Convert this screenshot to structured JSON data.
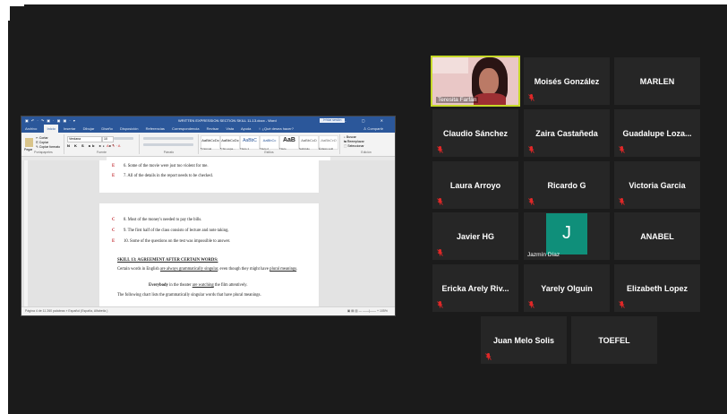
{
  "word": {
    "quick_access": "▣ ↶ · ↷ ▣ · ▣ ▣ · ▾",
    "doc_title": "WRITTEN EXPRESSION SECTION SKILL 11-13.docx  -  Word",
    "sign_in": "Iniciar sesión",
    "window_buttons": "▭ — ▢ ✕",
    "tabs": [
      "Archivo",
      "Inicio",
      "Insertar",
      "Dibujar",
      "Diseño",
      "Disposición",
      "Referencias",
      "Correspondencia",
      "Revisar",
      "Vista",
      "Ayuda",
      "♀ ¿Qué desea hacer?"
    ],
    "active_tab": "Inicio",
    "share": "♙ Compartir",
    "ribbon": {
      "clipboard_label": "Portapapeles",
      "paste": "Pegar",
      "cut": "✂ Cortar",
      "copy": "⎘ Copiar",
      "format_painter": "✎ Copiar formato",
      "font_name": "Verdana",
      "font_size": "10",
      "font_label": "Fuente",
      "paragraph_label": "Párrafo",
      "styles": [
        "AaBbCcDc",
        "AaBbCcDc",
        "AaBbC",
        "AaBbCc",
        "AaB",
        "AaBbCcD",
        "AaBbCcD"
      ],
      "style_names": [
        "¶ Normal",
        "¶ Sin espa...",
        "Título 1",
        "Título 2",
        "Título",
        "Subtítulo",
        "Énfasis sutil"
      ],
      "styles_label": "Estilos",
      "find": "⌕ Buscar",
      "replace": "⇆ Reemplazar",
      "select": "⬚ Seleccionar",
      "edit_label": "Edición"
    },
    "page1_items": [
      {
        "letter": "E",
        "text": "6.  Some of the movie were just too violent for me."
      },
      {
        "letter": "E",
        "text": "7.  All of the details in the report needs to be checked."
      }
    ],
    "page2_items": [
      {
        "letter": "C",
        "text": "8.  Most of the money's needed to pay the bills."
      },
      {
        "letter": "C",
        "text": "9.  The first half of the class consists of lecture and note taking."
      },
      {
        "letter": "E",
        "text": "10.  Some of the questions on the test was impossible to answer."
      }
    ],
    "skill_heading": "SKILL 13: AGREEMENT AFTER CERTAIN WORDS:",
    "para1_a": "Certain words in English ",
    "para1_u1": "are always grammatically singular",
    "para1_b": ", even though they might have ",
    "para1_u2": "plural meanings",
    "para1_c": ".",
    "example_bold": "Everybody",
    "example_a": " in the theater ",
    "example_u": "are watching",
    "example_b": " the film attentively.",
    "para2": "The following chart lists the grammatically singular words that have plural meanings.",
    "status_left": "Página 4 de 11     260 palabras     ⌖     Español (España, Alfabetiz.)",
    "status_right": "▣  ▤  ▥    —  ——|——  +   105%"
  },
  "participants": [
    {
      "name": "Teresita Farfán",
      "type": "video",
      "muted": false
    },
    {
      "name": "Moisés González",
      "type": "name",
      "muted": true
    },
    {
      "name": "MARLEN",
      "type": "name",
      "muted": false
    },
    {
      "name": "Claudio Sánchez",
      "type": "name",
      "muted": true
    },
    {
      "name": "Zaira Castañeda",
      "type": "name",
      "muted": true
    },
    {
      "name": "Guadalupe  Loza...",
      "type": "name",
      "muted": true
    },
    {
      "name": "Laura Arroyo",
      "type": "name",
      "muted": true
    },
    {
      "name": "Ricardo G",
      "type": "name",
      "muted": true
    },
    {
      "name": "Victoria Garcia",
      "type": "name",
      "muted": true
    },
    {
      "name": "Javier HG",
      "type": "name",
      "muted": true
    },
    {
      "name": "Jazmín Díaz",
      "type": "avatar",
      "initial": "J",
      "muted": false
    },
    {
      "name": "ANABEL",
      "type": "name",
      "muted": false
    },
    {
      "name": "Ericka Arely Riv...",
      "type": "name",
      "muted": true
    },
    {
      "name": "Yarely Olguin",
      "type": "name",
      "muted": true
    },
    {
      "name": "Elizabeth Lopez",
      "type": "name",
      "muted": true
    },
    {
      "name": "Juan Melo Solis",
      "type": "name",
      "muted": true
    },
    {
      "name": "TOEFEL",
      "type": "name",
      "muted": false
    }
  ],
  "colors": {
    "background": "#1b1b1b",
    "tile": "#262626",
    "active_speaker": "#c6d928",
    "muted_icon": "#e02828",
    "avatar": "#0f8f7a",
    "word_blue": "#2b579a"
  },
  "icons": {
    "muted": "mic-muted-icon"
  }
}
